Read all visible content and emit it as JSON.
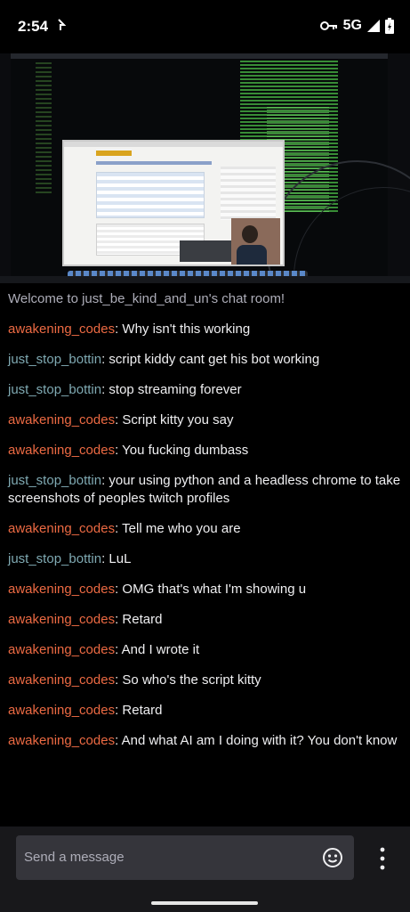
{
  "status_bar": {
    "time": "2:54",
    "network": "5G"
  },
  "chat": {
    "welcome": "Welcome to just_be_kind_and_un's chat room!",
    "messages": [
      {
        "user": "awakening_codes",
        "text": ": Why isn't this working",
        "color": "#ec6a43"
      },
      {
        "user": "just_stop_bottin",
        "text": ": script kiddy cant get his bot working",
        "color": "#7fa9b2"
      },
      {
        "user": "just_stop_bottin",
        "text": ": stop streaming forever",
        "color": "#7fa9b2"
      },
      {
        "user": "awakening_codes",
        "text": ": Script kitty you say",
        "color": "#ec6a43"
      },
      {
        "user": "awakening_codes",
        "text": ": You fucking dumbass",
        "color": "#ec6a43"
      },
      {
        "user": "just_stop_bottin",
        "text": ": your using python and a headless chrome to take screenshots of peoples twitch profiles",
        "color": "#7fa9b2"
      },
      {
        "user": "awakening_codes",
        "text": ": Tell me who you are",
        "color": "#ec6a43"
      },
      {
        "user": "just_stop_bottin",
        "text": ": LuL",
        "color": "#7fa9b2"
      },
      {
        "user": "awakening_codes",
        "text": ": OMG that's what I'm showing u",
        "color": "#ec6a43"
      },
      {
        "user": "awakening_codes",
        "text": ": Retard",
        "color": "#ec6a43"
      },
      {
        "user": "awakening_codes",
        "text": ": And I wrote it",
        "color": "#ec6a43"
      },
      {
        "user": "awakening_codes",
        "text": ": So who's the script kitty",
        "color": "#ec6a43"
      },
      {
        "user": "awakening_codes",
        "text": ": Retard",
        "color": "#ec6a43"
      },
      {
        "user": "awakening_codes",
        "text": ": And what AI am I doing with it? You don't know",
        "color": "#ec6a43"
      }
    ]
  },
  "input": {
    "placeholder": "Send a message",
    "emoji_icon": "emoji-smile-icon",
    "more_icon": "more-vertical-icon"
  },
  "colors": {
    "background": "#000000",
    "input_bar": "#18181b",
    "input_field": "#35353b"
  }
}
